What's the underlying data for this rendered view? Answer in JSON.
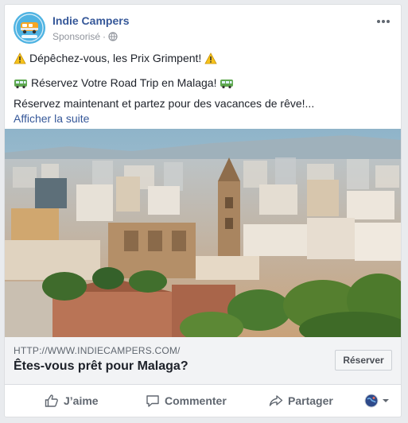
{
  "post": {
    "page_name": "Indie Campers",
    "sponsored_label": "Sponsorisé",
    "lines": [
      "Dépêchez-vous, les Prix Grimpent!",
      "Réservez Votre Road Trip en Malaga!",
      "Réservez maintenant et partez pour des vacances de rêve!..."
    ],
    "see_more": "Afficher la suite"
  },
  "link": {
    "url": "HTTP://WWW.INDIECAMPERS.COM/",
    "title": "Êtes-vous prêt pour Malaga?",
    "cta": "Réserver"
  },
  "actions": {
    "like": "J’aime",
    "comment": "Commenter",
    "share": "Partager"
  },
  "icons": {
    "more": "more-options-icon",
    "globe": "globe-icon",
    "warning": "warning-icon",
    "bus": "bus-icon",
    "like": "thumbs-up-icon",
    "comment": "comment-icon",
    "share": "share-icon",
    "audience": "audience-avatar-icon"
  },
  "colors": {
    "link_blue": "#365899",
    "text_dark": "#1d2129",
    "meta_gray": "#90949c",
    "avatar_bg": "#4fb3e2"
  }
}
